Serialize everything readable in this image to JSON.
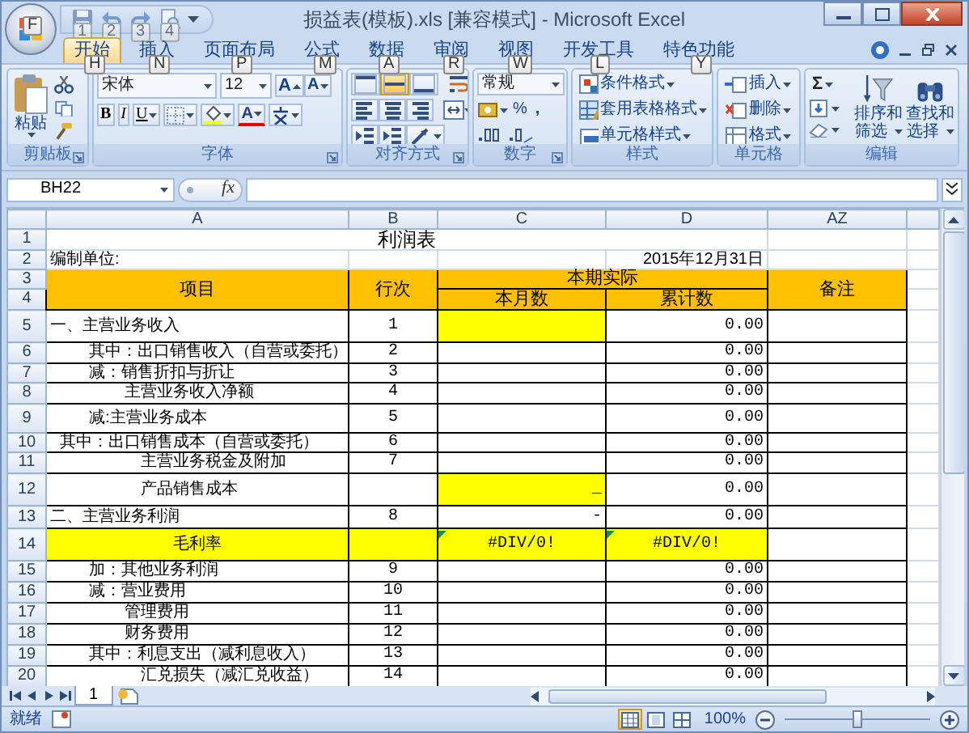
{
  "window": {
    "title": "损益表(模板).xls  [兼容模式] - Microsoft Excel",
    "office_keytip": "F",
    "quick_access_keytips": [
      "1",
      "2",
      "3",
      "4"
    ]
  },
  "tabs": [
    {
      "label": "开始",
      "keytip": "H",
      "selected": true
    },
    {
      "label": "插入",
      "keytip": "N",
      "selected": false
    },
    {
      "label": "页面布局",
      "keytip": "P",
      "selected": false
    },
    {
      "label": "公式",
      "keytip": "M",
      "selected": false
    },
    {
      "label": "数据",
      "keytip": "A",
      "selected": false
    },
    {
      "label": "审阅",
      "keytip": "R",
      "selected": false
    },
    {
      "label": "视图",
      "keytip": "W",
      "selected": false
    },
    {
      "label": "开发工具",
      "keytip": "L",
      "selected": false
    },
    {
      "label": "特色功能",
      "keytip": "Y",
      "selected": false
    }
  ],
  "ribbon": {
    "clipboard": {
      "label": "剪贴板",
      "paste": "粘贴"
    },
    "font": {
      "label": "字体",
      "name": "宋体",
      "size": "12",
      "grow": "A",
      "shrink": "A",
      "bold": "B",
      "italic": "I",
      "underline": "U",
      "font_color": "A"
    },
    "alignment": {
      "label": "对齐方式",
      "vertical": [
        {
          "selected": false
        },
        {
          "selected": true
        },
        {
          "selected": false
        }
      ]
    },
    "number": {
      "label": "数字",
      "format": "常规",
      "percent": "%",
      "comma": ","
    },
    "styles": {
      "label": "样式",
      "items": [
        "条件格式",
        "套用表格格式",
        "单元格样式"
      ]
    },
    "cells": {
      "label": "单元格",
      "items": [
        "插入",
        "删除",
        "格式"
      ]
    },
    "editing": {
      "label": "编辑",
      "sum": "Σ",
      "sort": [
        "排序和",
        "筛选"
      ],
      "find": [
        "查找和",
        "选择"
      ]
    }
  },
  "formula_bar": {
    "name_box": "BH22",
    "function_label": "fx"
  },
  "columns": [
    "A",
    "B",
    "C",
    "D",
    "AZ"
  ],
  "row_numbers": [
    "1",
    "2",
    "3",
    "4",
    "5",
    "6",
    "7",
    "8",
    "9",
    "10",
    "11",
    "12",
    "13",
    "14",
    "15",
    "16",
    "17",
    "18",
    "19",
    "20"
  ],
  "sheet": {
    "title": "利润表",
    "unit_label": "编制单位:",
    "date": "2015年12月31日",
    "headers": {
      "item": "项目",
      "line": "行次",
      "period": "本期实际",
      "month": "本月数",
      "total": "累计数",
      "note": "备注"
    },
    "rows": [
      {
        "item": "一、主营业务收入",
        "line": "1",
        "total": "0.00",
        "highlighted": false,
        "month_highlighted": true,
        "error_flag": false
      },
      {
        "item": "其中：出口销售收入（自营或委托）",
        "line": "2",
        "total": "0.00",
        "highlighted": false,
        "month_highlighted": false,
        "error_flag": false
      },
      {
        "item": "减：销售折扣与折让",
        "line": "3",
        "total": "0.00",
        "highlighted": false,
        "month_highlighted": false,
        "error_flag": false
      },
      {
        "item": "主营业务收入净额",
        "line": "4",
        "total": "0.00",
        "highlighted": false,
        "month_highlighted": false,
        "error_flag": false
      },
      {
        "item": "减:主营业务成本",
        "line": "5",
        "total": "0.00",
        "highlighted": false,
        "month_highlighted": false,
        "error_flag": false
      },
      {
        "item": "其中：出口销售成本（自营或委托）",
        "line": "6",
        "total": "0.00",
        "highlighted": false,
        "month_highlighted": false,
        "error_flag": false
      },
      {
        "item": "主营业务税金及附加",
        "line": "7",
        "total": "0.00",
        "highlighted": false,
        "month_highlighted": false,
        "error_flag": false
      },
      {
        "item": "产品销售成本",
        "month": "_",
        "total": "0.00",
        "highlighted": false,
        "month_highlighted": true,
        "error_flag": false
      },
      {
        "item": "二、主营业务利润",
        "line": "8",
        "month": "-",
        "total": "0.00",
        "highlighted": false,
        "month_highlighted": false,
        "error_flag": false
      },
      {
        "item": "毛利率",
        "month": "#DIV/0!",
        "total": "#DIV/0!",
        "highlighted": true,
        "month_highlighted": false,
        "error_flag": true
      },
      {
        "item": "加：其他业务利润",
        "line": "9",
        "total": "0.00",
        "highlighted": false,
        "month_highlighted": false,
        "error_flag": false
      },
      {
        "item": "减：营业费用",
        "line": "10",
        "total": "0.00",
        "highlighted": false,
        "month_highlighted": false,
        "error_flag": false
      },
      {
        "item": "管理费用",
        "line": "11",
        "total": "0.00",
        "highlighted": false,
        "month_highlighted": false,
        "error_flag": false
      },
      {
        "item": "财务费用",
        "line": "12",
        "total": "0.00",
        "highlighted": false,
        "month_highlighted": false,
        "error_flag": false
      },
      {
        "item": "其中：利息支出（减利息收入）",
        "line": "13",
        "total": "0.00",
        "highlighted": false,
        "month_highlighted": false,
        "error_flag": false
      },
      {
        "item": "汇兑损失（减汇兑收益）",
        "line": "14",
        "total": "0.00",
        "highlighted": false,
        "month_highlighted": false,
        "error_flag": false
      }
    ]
  },
  "sheet_tabs": [
    {
      "label": "1",
      "selected": true
    }
  ],
  "status_bar": {
    "status": "就绪",
    "views": [
      {
        "selected": true
      },
      {
        "selected": false
      },
      {
        "selected": false
      }
    ],
    "zoom": "100%",
    "zoom_slider": {
      "level": 0.5
    }
  }
}
